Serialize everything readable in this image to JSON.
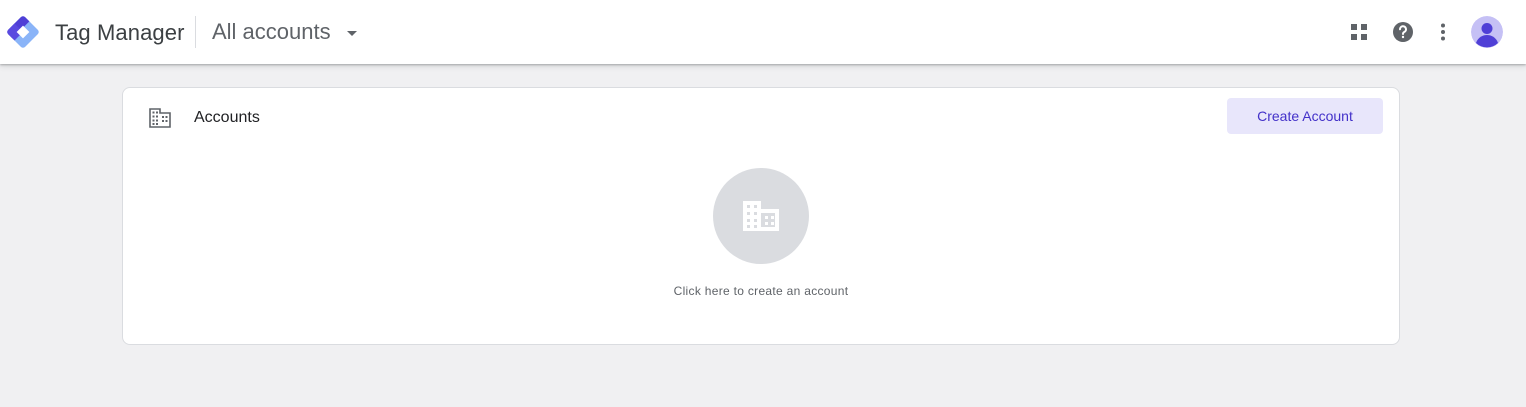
{
  "header": {
    "app_title": "Tag Manager",
    "account_picker_label": "All accounts",
    "icons": [
      "apps-grid-icon",
      "help-icon",
      "more-vert-icon",
      "avatar-icon"
    ]
  },
  "card": {
    "title": "Accounts",
    "create_button_label": "Create Account",
    "empty_state_text": "Click here to create an account"
  },
  "colors": {
    "brand_blue": "#8ab4f8",
    "brand_purple": "#4f3fd6",
    "button_bg": "#e8e6fb",
    "button_text": "#4331c9",
    "page_bg": "#f0f0f2"
  }
}
